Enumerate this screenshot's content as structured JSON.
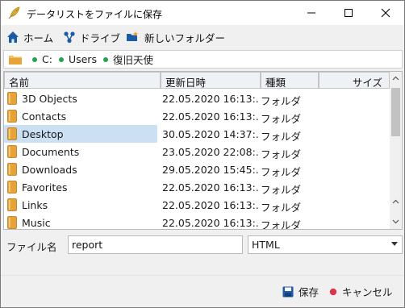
{
  "window": {
    "title": "データリストをファイルに保存",
    "controls": {
      "minimize": "minimize",
      "maximize": "maximize",
      "close": "close"
    }
  },
  "toolbar": {
    "home_label": "ホーム",
    "drive_label": "ドライブ",
    "new_folder_label": "新しいフォルダー"
  },
  "address": {
    "crumbs": [
      "C:",
      "Users",
      "復旧天使"
    ]
  },
  "list": {
    "columns": {
      "name": "名前",
      "date": "更新日時",
      "type": "種類",
      "size": "サイズ"
    },
    "rows": [
      {
        "name": "3D Objects",
        "date": "22.05.2020 16:13:...",
        "type": "フォルダ"
      },
      {
        "name": "Contacts",
        "date": "22.05.2020 16:13:...",
        "type": "フォルダ"
      },
      {
        "name": "Desktop",
        "date": "30.05.2020 14:37:...",
        "type": "フォルダ"
      },
      {
        "name": "Documents",
        "date": "23.05.2020 22:08:...",
        "type": "フォルダ"
      },
      {
        "name": "Downloads",
        "date": "29.05.2020 15:45:...",
        "type": "フォルダ"
      },
      {
        "name": "Favorites",
        "date": "22.05.2020 16:13:...",
        "type": "フォルダ"
      },
      {
        "name": "Links",
        "date": "22.05.2020 16:13:...",
        "type": "フォルダ"
      },
      {
        "name": "Music",
        "date": "22.05.2020 16:13:...",
        "type": "フォルダ"
      }
    ],
    "selected_index": 2
  },
  "form": {
    "filename_label": "ファイル名",
    "filename_value": "report",
    "filetype_value": "HTML"
  },
  "buttons": {
    "save_label": "保存",
    "cancel_label": "キャンセル"
  },
  "colors": {
    "accent_blue": "#1c5aa6",
    "folder_orange": "#e8a23a",
    "cancel_red": "#d8364b",
    "crumb_green": "#1fa64a",
    "selection": "#cce0f4"
  }
}
